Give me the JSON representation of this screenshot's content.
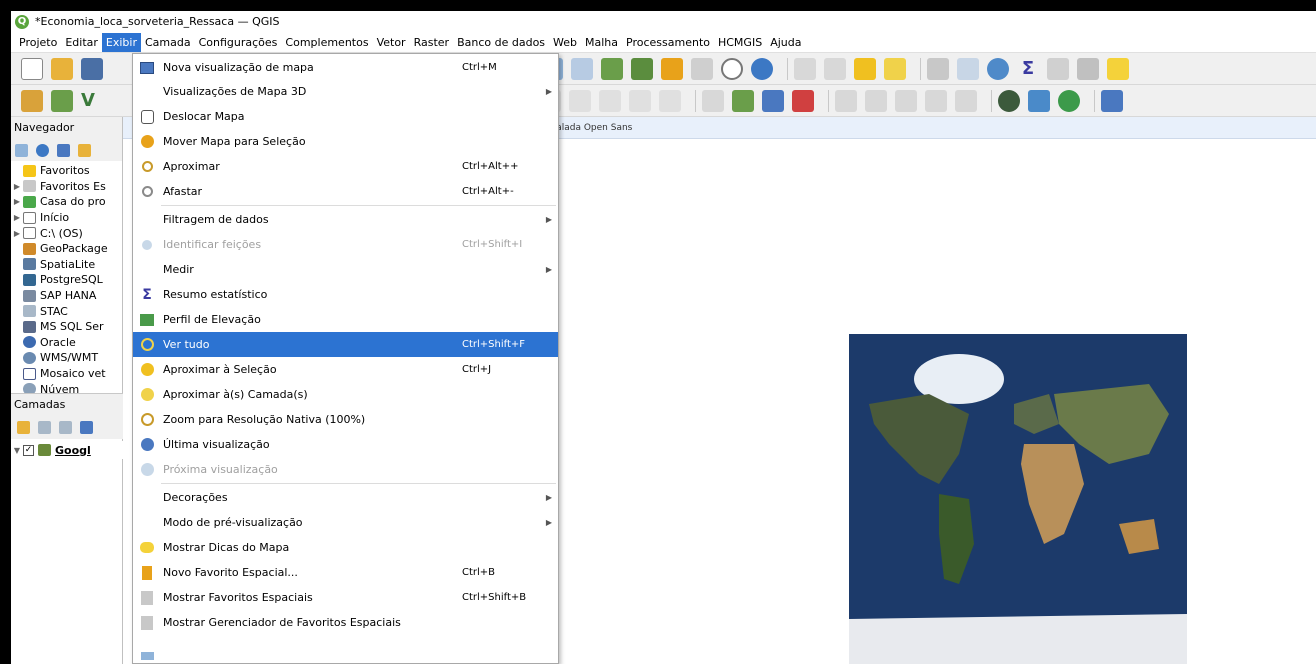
{
  "window": {
    "title": "*Economia_loca_sorveteria_Ressaca — QGIS"
  },
  "menubar": [
    "Projeto",
    "Editar",
    "Exibir",
    "Camada",
    "Configurações",
    "Complementos",
    "Vetor",
    "Raster",
    "Banco de dados",
    "Web",
    "Malha",
    "Processamento",
    "HCMGIS",
    "Ajuda"
  ],
  "browser": {
    "title": "Navegador",
    "items": [
      "Favoritos",
      "Favoritos Es",
      "Casa do pro",
      "Início",
      "C:\\ (OS)",
      "GeoPackage",
      "SpatiaLite",
      "PostgreSQL",
      "SAP HANA",
      "STAC",
      "MS SQL Ser",
      "Oracle",
      "WMS/WMT",
      "Mosaico vet",
      "Núvem"
    ]
  },
  "layers": {
    "title": "Camadas",
    "layer_name": "Googl"
  },
  "infobar": {
    "text": "stalada Open Sans"
  },
  "view_menu": {
    "items": [
      {
        "label": "Nova visualização de mapa",
        "shortcut": "Ctrl+M"
      },
      {
        "label": "Visualizações de Mapa 3D",
        "shortcut": ""
      },
      {
        "label": "Deslocar Mapa",
        "shortcut": ""
      },
      {
        "label": "Mover Mapa para Seleção",
        "shortcut": ""
      },
      {
        "label": "Aproximar",
        "shortcut": "Ctrl+Alt++"
      },
      {
        "label": "Afastar",
        "shortcut": "Ctrl+Alt+-"
      },
      {
        "label": "Filtragem de dados",
        "shortcut": ""
      },
      {
        "label": "Identificar feições",
        "shortcut": "Ctrl+Shift+I"
      },
      {
        "label": "Medir",
        "shortcut": ""
      },
      {
        "label": "Resumo estatístico",
        "shortcut": ""
      },
      {
        "label": "Perfil de Elevação",
        "shortcut": ""
      },
      {
        "label": "Ver tudo",
        "shortcut": "Ctrl+Shift+F"
      },
      {
        "label": "Aproximar à Seleção",
        "shortcut": "Ctrl+J"
      },
      {
        "label": "Aproximar à(s) Camada(s)",
        "shortcut": ""
      },
      {
        "label": "Zoom para Resolução Nativa (100%)",
        "shortcut": ""
      },
      {
        "label": "Última visualização",
        "shortcut": ""
      },
      {
        "label": "Próxima visualização",
        "shortcut": ""
      },
      {
        "label": "Decorações",
        "shortcut": ""
      },
      {
        "label": "Modo de pré-visualização",
        "shortcut": ""
      },
      {
        "label": "Mostrar Dicas do Mapa",
        "shortcut": ""
      },
      {
        "label": "Novo Favorito Espacial...",
        "shortcut": "Ctrl+B"
      },
      {
        "label": "Mostrar Favoritos Espaciais",
        "shortcut": "Ctrl+Shift+B"
      },
      {
        "label": "Mostrar Gerenciador de Favoritos Espaciais",
        "shortcut": ""
      }
    ]
  },
  "colors": {
    "highlight": "#2c73d2",
    "infobar": "#e8f0fb"
  }
}
